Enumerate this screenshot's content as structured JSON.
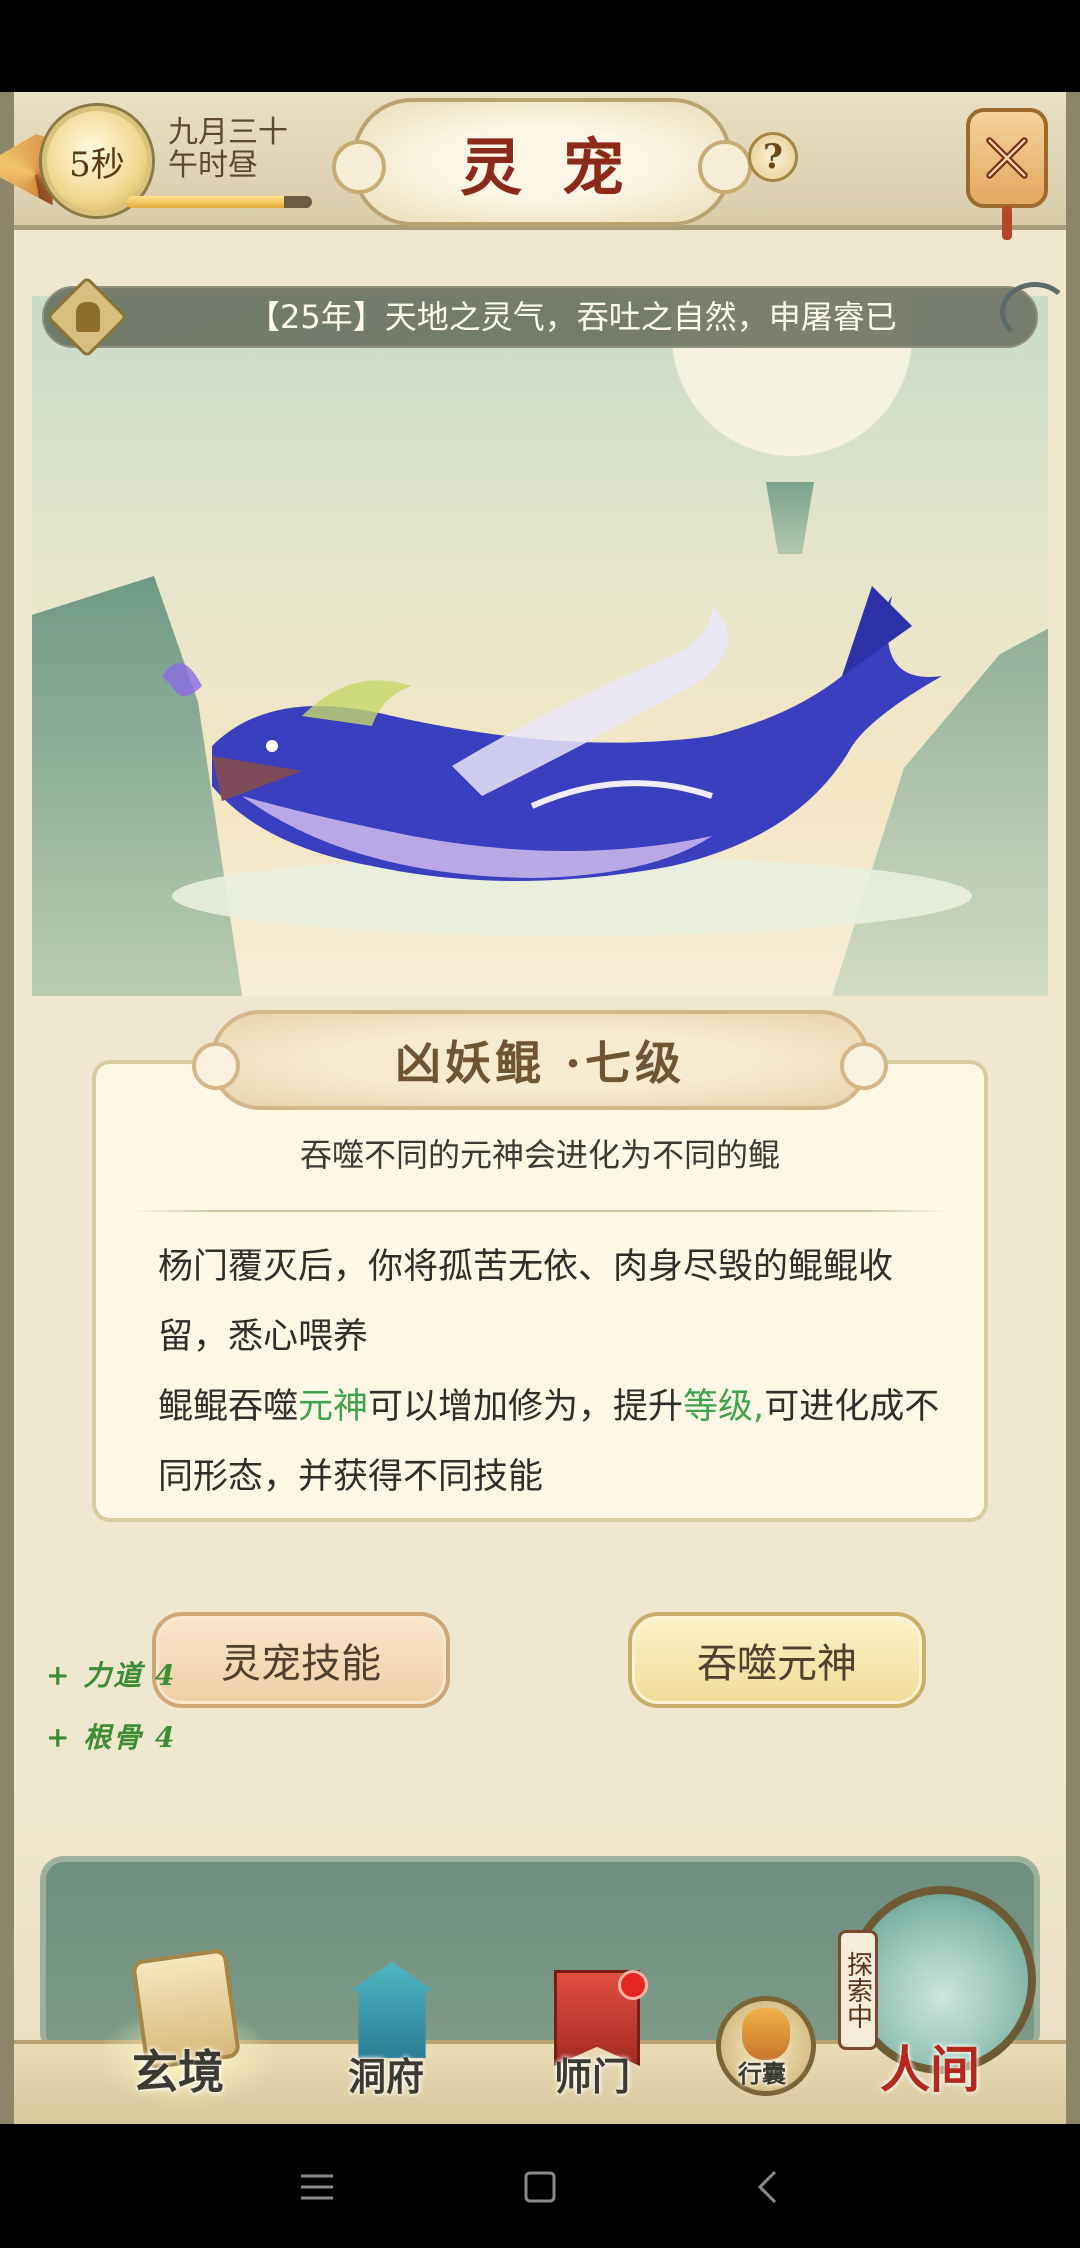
{
  "header": {
    "timer": "5秒",
    "date_line1": "九月三十",
    "date_line2": "午时昼",
    "time_progress": 0.85,
    "title": "灵宠",
    "help_label": "?"
  },
  "notice": {
    "text": "【25年】天地之灵气，吞吐之自然，申屠睿已"
  },
  "pet": {
    "name": "凶妖鲲 ·七级",
    "subtitle": "吞噬不同的元神会进化为不同的鲲",
    "desc_p1": "杨门覆灭后，你将孤苦无依、肉身尽毁的鲲鲲收留，悉心喂养",
    "desc_p2_a": "鲲鲲吞噬",
    "desc_p2_green1": "元神",
    "desc_p2_b": "可以增加修为，提升",
    "desc_p2_green2": "等级,",
    "desc_p2_c": "可进化成不同形态，并获得不同技能"
  },
  "actions": {
    "skill_button": "灵宠技能",
    "devour_button": "吞噬元神"
  },
  "stats": [
    "+ 力道 4",
    "+ 根骨 4"
  ],
  "bottom_nav": {
    "items": [
      {
        "label": "玄境"
      },
      {
        "label": "洞府"
      },
      {
        "label": "师门"
      },
      {
        "label": "行囊"
      },
      {
        "label": "人间"
      }
    ],
    "explore_tag": "探索中"
  },
  "colors": {
    "title_red": "#8b2a18",
    "highlight_green": "#3fa34a",
    "stat_green": "#3d8d34",
    "parchment": "#fdf8e6"
  }
}
